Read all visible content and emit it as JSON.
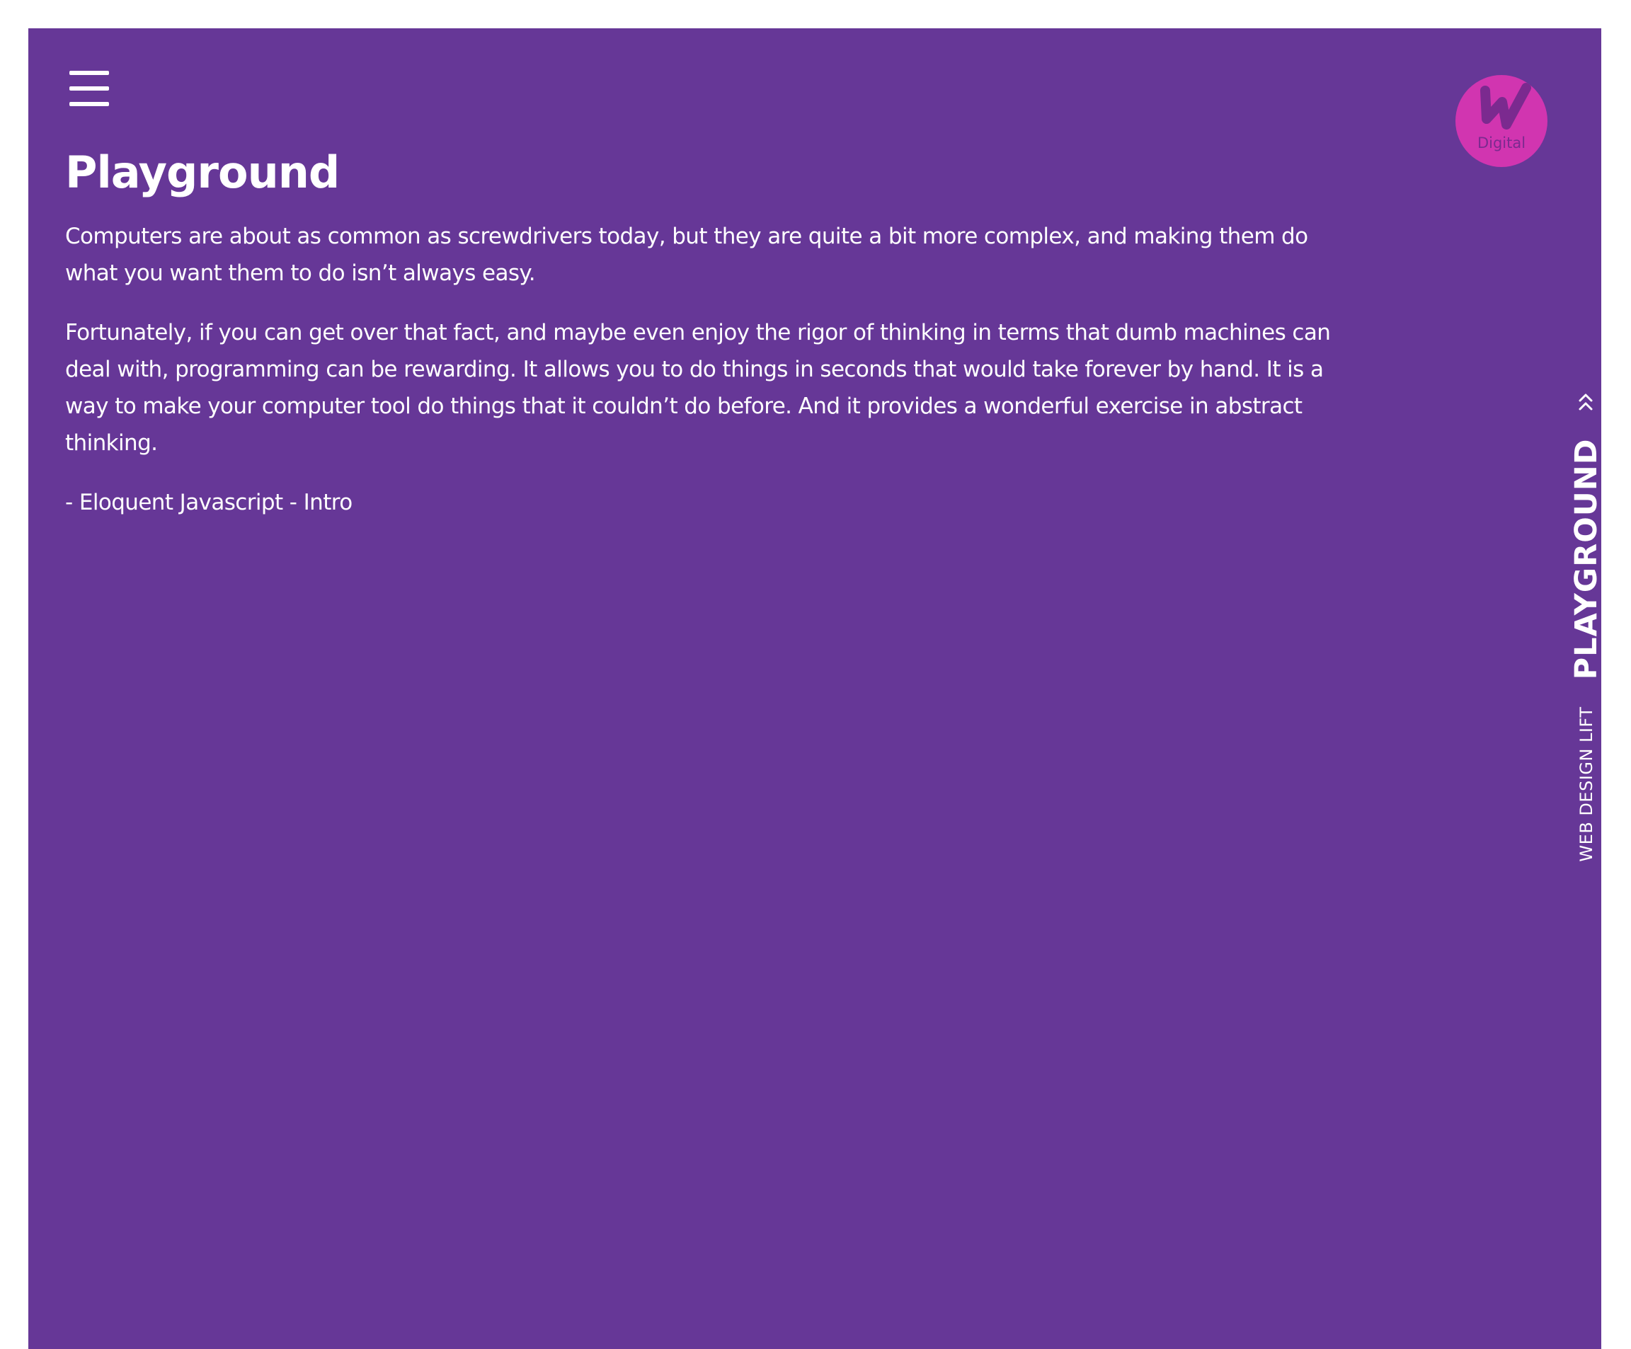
{
  "header": {
    "menu_icon": "hamburger-menu-icon",
    "logo": {
      "text": "Digital",
      "color": "#d135b0"
    }
  },
  "main": {
    "title": "Playground",
    "paragraphs": [
      "Computers are about as common as screwdrivers today, but they are quite a bit more complex, and making them do what you want them to do isn’t always easy.",
      "Fortunately, if you can get over that fact, and maybe even enjoy the rigor of thinking in terms that dumb machines can deal with, programming can be rewarding. It allows you to do things in seconds that would take forever by hand. It is a way to make your computer tool do things that it couldn’t do before. And it provides a wonderful exercise in abstract thinking.",
      "- Eloquent Javascript - Intro"
    ]
  },
  "side_nav": {
    "up_icon": "chevron-up-icon",
    "current": "PLAYGROUND",
    "next": "WEB DESIGN LIFT"
  },
  "colors": {
    "background": "#663797",
    "text": "#ffffff",
    "accent": "#d135b0"
  }
}
